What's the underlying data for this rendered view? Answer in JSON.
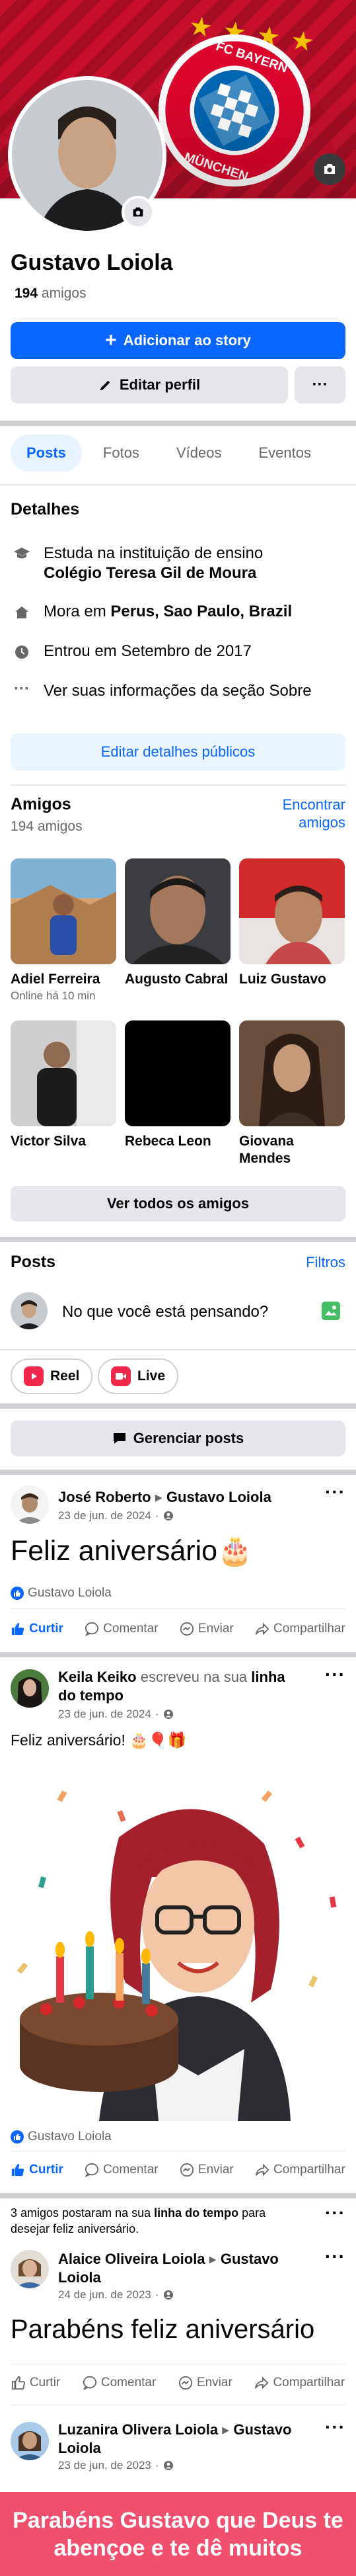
{
  "profile": {
    "name": "Gustavo Loiola",
    "friends_count_number": "194",
    "friends_count_suffix": "amigos"
  },
  "buttons": {
    "add_story": "Adicionar ao story",
    "edit_profile": "Editar perfil",
    "more": "···"
  },
  "tabs": [
    {
      "label": "Posts",
      "active": true
    },
    {
      "label": "Fotos",
      "active": false
    },
    {
      "label": "Vídeos",
      "active": false
    },
    {
      "label": "Eventos",
      "active": false
    }
  ],
  "details": {
    "title": "Detalhes",
    "education_prefix": "Estuda na instituição de ensino",
    "education_place": "Colégio Teresa Gil de Moura",
    "lives_prefix": "Mora em",
    "lives_place": "Perus, Sao Paulo, Brazil",
    "joined": "Entrou em Setembro de 2017",
    "about": "Ver suas informações da seção Sobre",
    "edit_public": "Editar detalhes públicos"
  },
  "friends": {
    "title": "Amigos",
    "count": "194 amigos",
    "find_link": "Encontrar amigos",
    "see_all": "Ver todos os amigos",
    "items": [
      {
        "name": "Adiel Ferreira",
        "status": "Online há 10 min"
      },
      {
        "name": "Augusto Cabral",
        "status": ""
      },
      {
        "name": "Luiz Gustavo",
        "status": ""
      },
      {
        "name": "Victor Silva",
        "status": ""
      },
      {
        "name": "Rebeca Leon",
        "status": ""
      },
      {
        "name": "Giovana Mendes",
        "status": ""
      }
    ]
  },
  "posts_section": {
    "title": "Posts",
    "filters": "Filtros",
    "composer_placeholder": "No que você está pensando?",
    "reel": "Reel",
    "live": "Live",
    "manage": "Gerenciar posts"
  },
  "post1": {
    "author": "José Roberto",
    "target": "Gustavo Loiola",
    "date": "23 de jun. de 2024",
    "text": "Feliz aniversário🎂",
    "liked_by": "Gustavo Loiola"
  },
  "post2": {
    "author": "Keila Keiko",
    "verb": "escreveu na sua",
    "link": "linha do tempo",
    "date": "23 de jun. de 2024",
    "text": "Feliz aniversário! 🎂🎈🎁",
    "liked_by": "Gustavo Loiola"
  },
  "actions": {
    "like": "Curtir",
    "comment": "Comentar",
    "send": "Enviar",
    "share": "Compartilhar"
  },
  "group_note": {
    "prefix": "3 amigos postaram na sua",
    "link": "linha do tempo",
    "suffix": "para desejar feliz aniversário."
  },
  "post3": {
    "author": "Alaice Oliveira Loiola",
    "target": "Gustavo Loiola",
    "date": "24 de jun. de 2023",
    "text": "Parabéns feliz aniversário"
  },
  "post4": {
    "author": "Luzanira Olivera Loiola",
    "target": "Gustavo Loiola",
    "date": "23 de jun. de 2023"
  },
  "banner": {
    "text": "Parabéns Gustavo que Deus te abençoe e te dê muitos"
  },
  "colors": {
    "brand": "#0866ff",
    "cover_red": "#c8102e",
    "banner": "#f0506e"
  }
}
